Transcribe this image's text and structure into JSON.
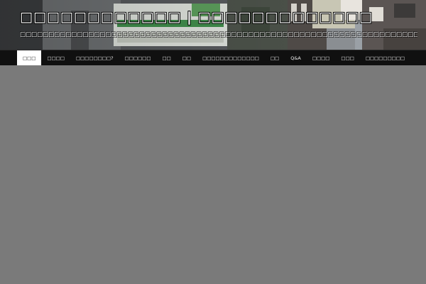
{
  "header": {
    "site_title": "□□□□□□□□□□□□ | □□□□□□□□□□□□□",
    "tagline": "□□□□□□□□□□□□□□□□□□□□□□□□□□□□□□□□□□□□□□□□□□□□□□□□□□□□□□□□□□□□□□□□□□□□□□□□"
  },
  "nav": {
    "items": [
      {
        "label": "□□□"
      },
      {
        "label": "□□□□"
      },
      {
        "label": "□□□□□□□□?"
      },
      {
        "label": "□□□□□□"
      },
      {
        "label": "□□"
      },
      {
        "label": "□□"
      },
      {
        "label": "□□□□□□□□□□□□□"
      },
      {
        "label": "□□"
      },
      {
        "label": "Q&A"
      },
      {
        "label": "□□□□"
      },
      {
        "label": "□□□"
      },
      {
        "label": "□□□□□□□□□"
      }
    ]
  },
  "colors": {
    "page_background": "#7a7a7a",
    "nav_background": "#101010",
    "nav_active": "#ffffff"
  }
}
